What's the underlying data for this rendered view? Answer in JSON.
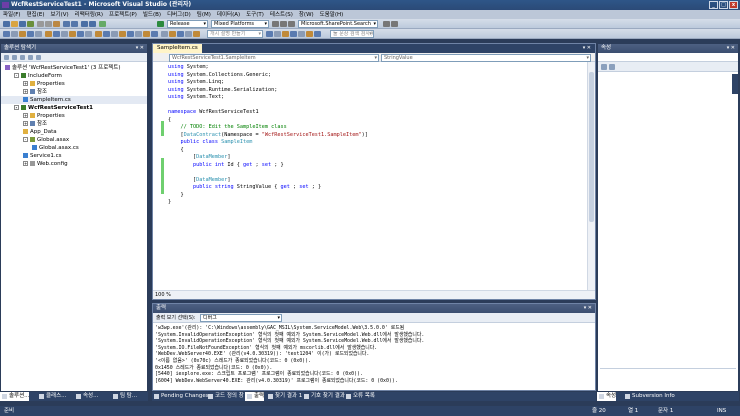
{
  "window": {
    "title": "WcfRestServiceTest1 - Microsoft Visual Studio (관리자)"
  },
  "menu": [
    "파일(F)",
    "편집(E)",
    "보기(V)",
    "리팩터링(R)",
    "프로젝트(P)",
    "빌드(B)",
    "디버그(D)",
    "팀(M)",
    "데이터(A)",
    "도구(T)",
    "테스트(S)",
    "창(W)",
    "도움말(H)"
  ],
  "toolbar": {
    "config": "Release",
    "platform": "Mixed Platforms",
    "target": "Microsoft.SharePoint.Search",
    "search_placeholder": "개시 설명 만들기",
    "find_placeholder": "둘 문상 검색 검사(C)"
  },
  "solution_explorer": {
    "title": "솔루션 탐색기",
    "items": [
      {
        "label": "솔루션 'WcfRestServiceTest1' (3 프로젝트)",
        "indent": 0,
        "icon": "solution",
        "bold": false
      },
      {
        "label": "IncludeForm",
        "indent": 1,
        "icon": "project",
        "exp": "-"
      },
      {
        "label": "Properties",
        "indent": 2,
        "icon": "folder",
        "exp": "+"
      },
      {
        "label": "참조",
        "indent": 2,
        "icon": "ref",
        "exp": "+"
      },
      {
        "label": "SampleItem.cs",
        "indent": 2,
        "icon": "cs"
      },
      {
        "label": "WcfRestServiceTest1",
        "indent": 1,
        "icon": "project",
        "exp": "-",
        "bold": true
      },
      {
        "label": "Properties",
        "indent": 2,
        "icon": "folder",
        "exp": "+"
      },
      {
        "label": "참조",
        "indent": 2,
        "icon": "ref",
        "exp": "+"
      },
      {
        "label": "App_Data",
        "indent": 2,
        "icon": "folder"
      },
      {
        "label": "Global.asax",
        "indent": 2,
        "icon": "asax",
        "exp": "-"
      },
      {
        "label": "Global.asax.cs",
        "indent": 3,
        "icon": "cs"
      },
      {
        "label": "Service1.cs",
        "indent": 2,
        "icon": "cs"
      },
      {
        "label": "Web.config",
        "indent": 2,
        "icon": "config",
        "exp": "+"
      }
    ]
  },
  "editor": {
    "tab": "SampleItem.cs",
    "nav_left": "WcfRestServiceTest1.SampleItem",
    "nav_right": "StringValue",
    "zoom": "100 %",
    "lines": [
      [
        [
          "kw",
          "using"
        ],
        [
          "",
          "System;"
        ]
      ],
      [
        [
          "kw",
          "using"
        ],
        [
          "",
          "System.Collections.Generic;"
        ]
      ],
      [
        [
          "kw",
          "using"
        ],
        [
          "",
          "System.Linq;"
        ]
      ],
      [
        [
          "kw",
          "using"
        ],
        [
          "",
          "System.Runtime.Serialization;"
        ]
      ],
      [
        [
          "kw",
          "using"
        ],
        [
          "",
          "System.Text;"
        ]
      ],
      [
        [
          "",
          ""
        ]
      ],
      [
        [
          "kw",
          "namespace"
        ],
        [
          "",
          "WcfRestServiceTest1"
        ]
      ],
      [
        [
          "",
          "{"
        ]
      ],
      [
        [
          "",
          "    "
        ],
        [
          "cm",
          "// TODO: Edit the SampleItem class"
        ]
      ],
      [
        [
          "",
          "    ["
        ],
        [
          "ty",
          "DataContract"
        ],
        [
          "",
          "(Namespace = "
        ],
        [
          "st",
          "\"WcfRestServiceTest1.SampleItem\""
        ],
        [
          "",
          ")]"
        ]
      ],
      [
        [
          "",
          "    "
        ],
        [
          "kw",
          "public class"
        ],
        [
          "",
          ""
        ],
        [
          "ty",
          "SampleItem"
        ]
      ],
      [
        [
          "",
          "    {"
        ]
      ],
      [
        [
          "",
          "        ["
        ],
        [
          "ty",
          "DataMember"
        ],
        [
          "",
          "]"
        ]
      ],
      [
        [
          "",
          "        "
        ],
        [
          "kw",
          "public int"
        ],
        [
          "",
          "Id { "
        ],
        [
          "kw",
          "get"
        ],
        [
          "",
          "; "
        ],
        [
          "kw",
          "set"
        ],
        [
          "",
          "; }"
        ]
      ],
      [
        [
          "",
          ""
        ]
      ],
      [
        [
          "",
          "        ["
        ],
        [
          "ty",
          "DataMember"
        ],
        [
          "",
          "]"
        ]
      ],
      [
        [
          "",
          "        "
        ],
        [
          "kw",
          "public string"
        ],
        [
          "",
          "StringValue { "
        ],
        [
          "kw",
          "get"
        ],
        [
          "",
          "; "
        ],
        [
          "kw",
          "set"
        ],
        [
          "",
          "; }"
        ]
      ],
      [
        [
          "",
          "    }"
        ]
      ],
      [
        [
          "",
          "}"
        ]
      ],
      [
        [
          "",
          ""
        ]
      ]
    ]
  },
  "properties": {
    "title": "속성"
  },
  "output": {
    "title": "출력",
    "source_label": "출력 보기 선택(S):",
    "source": "디버그",
    "lines": [
      "'w3wp.exe'(관리): 'C:\\Windows\\assembly\\GAC_MSIL\\System.ServiceModel.Web\\3.5.0.0' 로드됨",
      "'System.InvalidOperationException' 형식의 첫째 예외가 System.ServiceModel.Web.dll에서 발생했습니다.",
      "'System.InvalidOperationException' 형식의 첫째 예외가 System.ServiceModel.Web.dll에서 발생했습니다.",
      "'System.IO.FileNotFoundException' 형식의 첫째 예외가 mscorlib.dll에서 발생했습니다.",
      "'WebDev.WebServer40.EXE' (관리(v4.0.30319)): 'test1204' 이(가) 로드되었습니다.",
      "'<이름 없음>' (0x70c) 스레드가 종료되었습니다(코드: 0 (0x0)).",
      "0x1450 스레드가 종료되었습니다(코드: 0 (0x0)).",
      "[5440] iexplore.exe: 스크립트 프로그램' 프로그램이 종료되었습니다(코드: 0 (0x0)).",
      "[6004] WebDev.WebServer40.EXE: 관리(v4.0.30319)' 프로그램이 종료되었습니다(코드: 0 (0x0))."
    ]
  },
  "left_tabs": [
    "솔루션...",
    "클래스...",
    "속성...",
    "팀 탐..."
  ],
  "bottom_tabs": [
    "Pending Changes",
    "코드 정의 창",
    "출력",
    "찾기 결과 1",
    "기호 찾기 결과",
    "오류 목록"
  ],
  "right_tabs": [
    "속성",
    "Subversion Info"
  ],
  "status": {
    "ready": "준비",
    "ln": "줄 20",
    "col": "열 1",
    "ch": "문자 1",
    "ins": "INS"
  }
}
